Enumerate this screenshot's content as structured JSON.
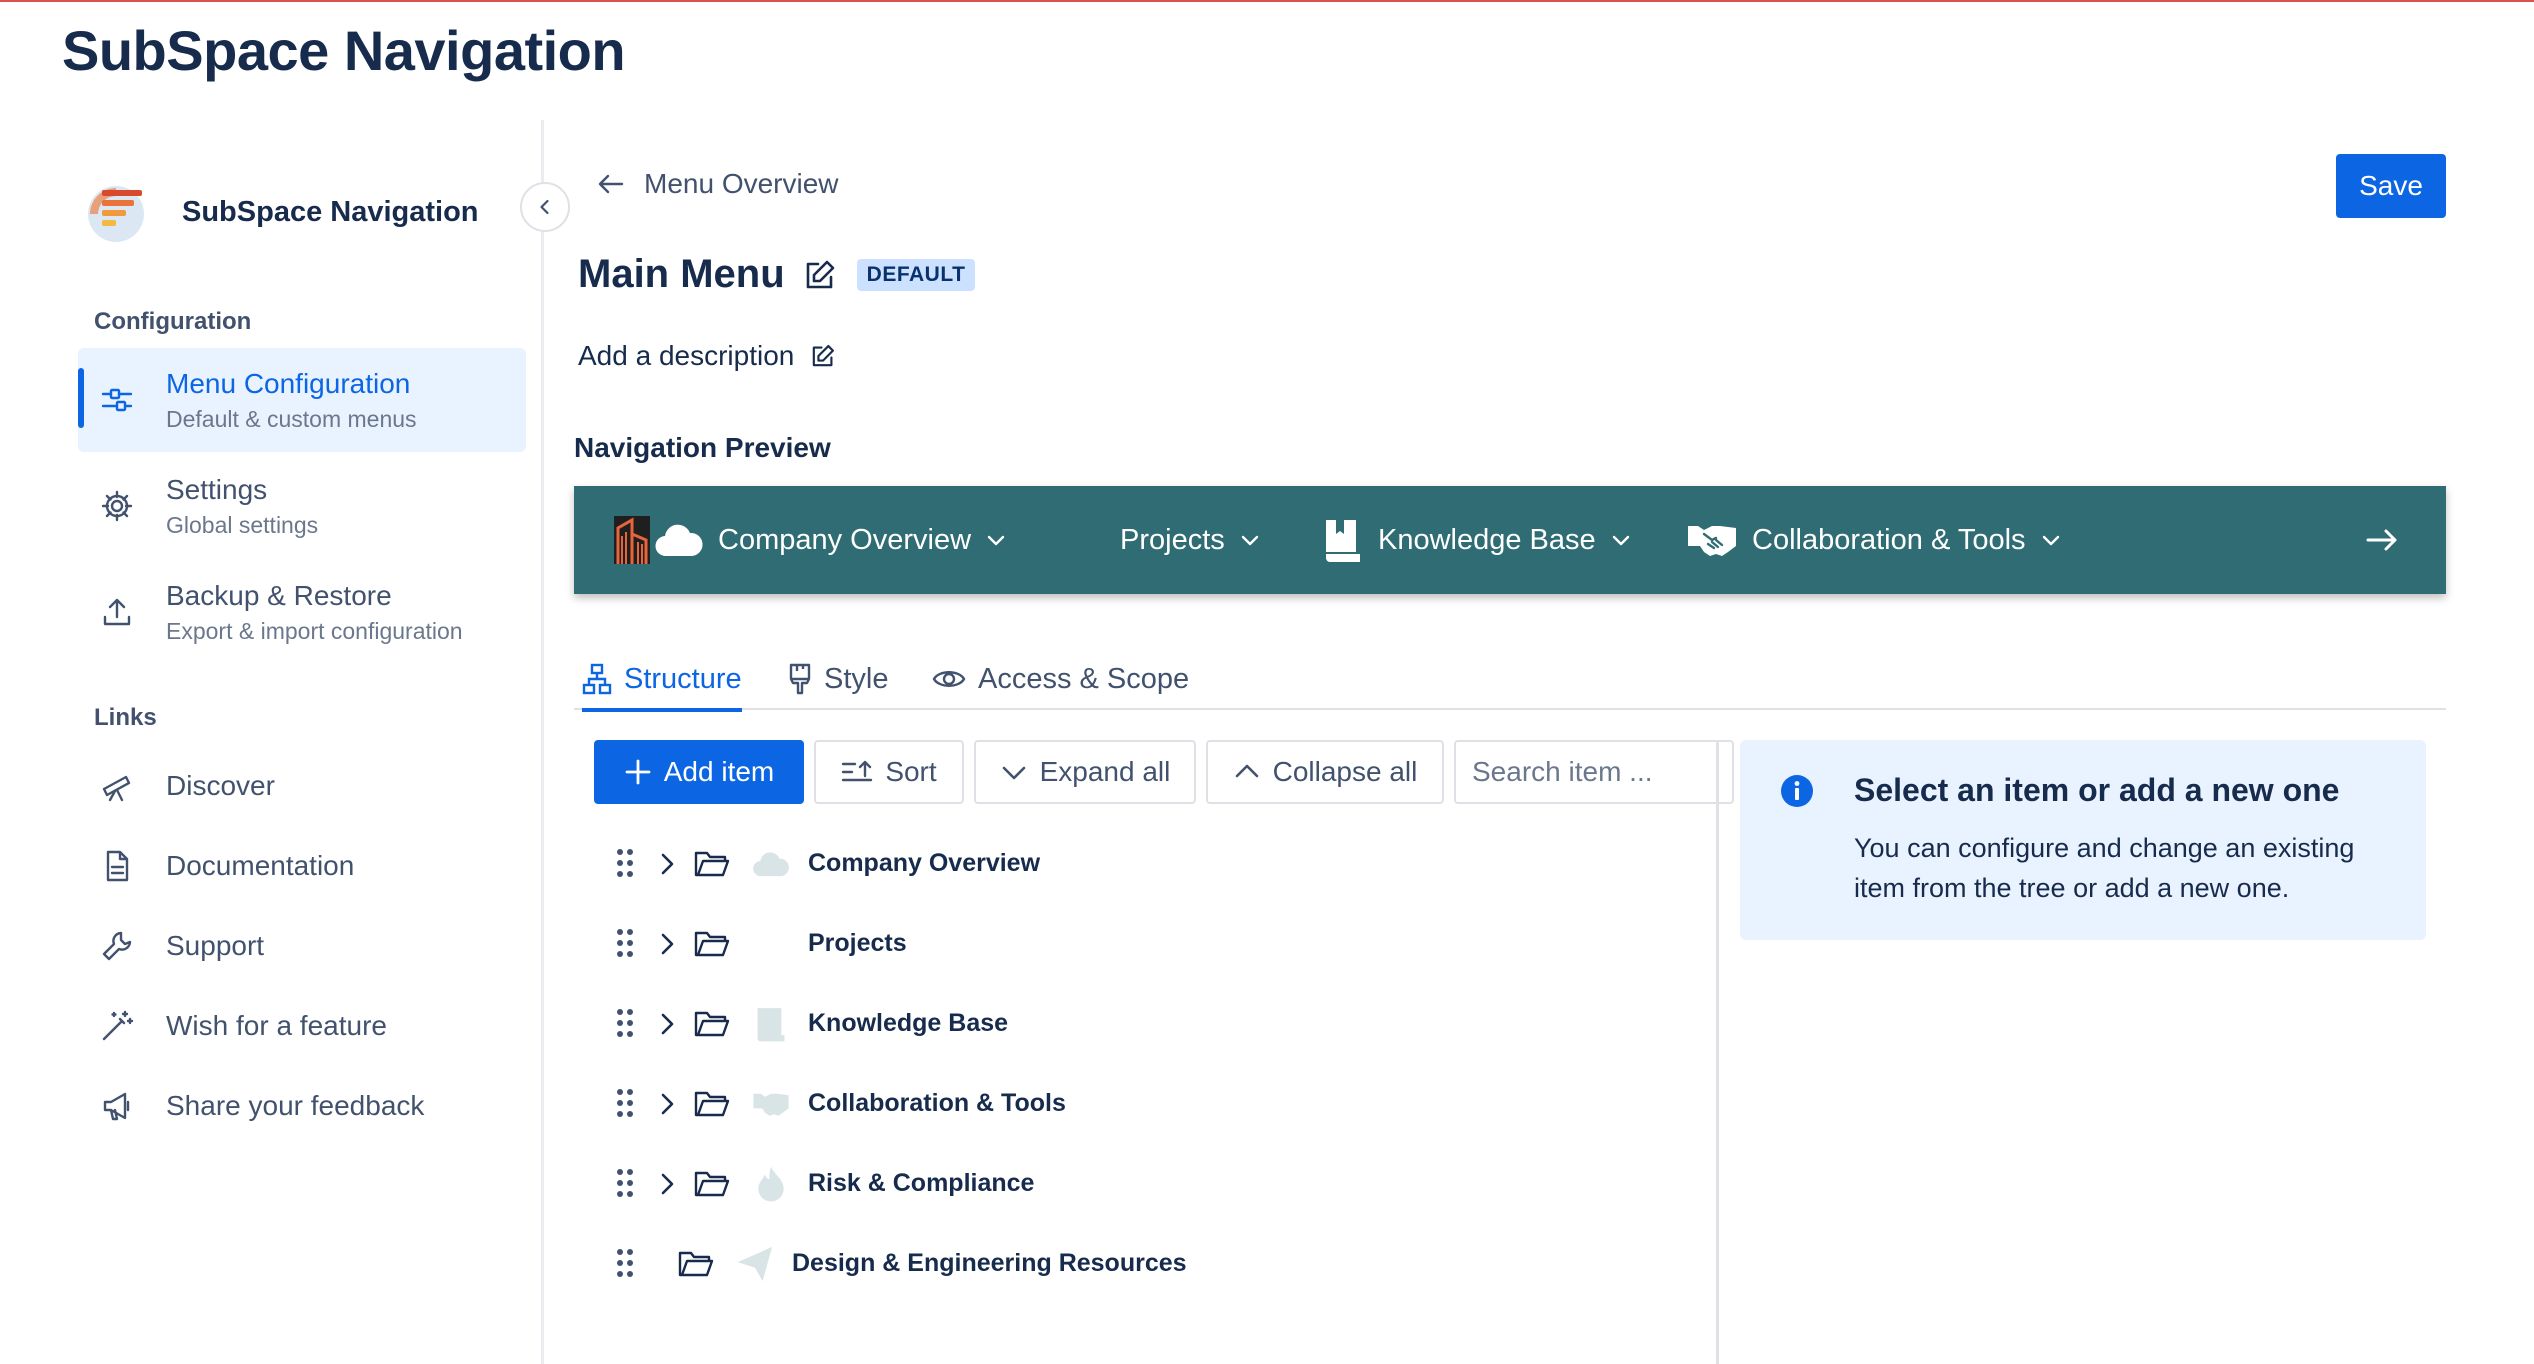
{
  "page": {
    "title": "SubSpace Navigation"
  },
  "sidebar": {
    "brand_name": "SubSpace Navigation",
    "configuration_label": "Configuration",
    "config_items": [
      {
        "title": "Menu Configuration",
        "subtitle": "Default & custom menus",
        "icon": "sliders-icon"
      },
      {
        "title": "Settings",
        "subtitle": "Global settings",
        "icon": "gear-icon"
      },
      {
        "title": "Backup & Restore",
        "subtitle": "Export & import configuration",
        "icon": "upload-icon"
      }
    ],
    "links_label": "Links",
    "links": [
      {
        "title": "Discover",
        "icon": "telescope-icon"
      },
      {
        "title": "Documentation",
        "icon": "document-icon"
      },
      {
        "title": "Support",
        "icon": "wrench-icon"
      },
      {
        "title": "Wish for a feature",
        "icon": "magic-wand-icon"
      },
      {
        "title": "Share your feedback",
        "icon": "megaphone-icon"
      }
    ]
  },
  "header": {
    "back_label": "Menu Overview",
    "save_label": "Save",
    "menu_title": "Main Menu",
    "badge": "DEFAULT",
    "description_placeholder": "Add a description",
    "preview_heading": "Navigation Preview"
  },
  "preview": {
    "bg_color": "#2f6c73",
    "items": [
      {
        "label": "Company Overview",
        "icon": "cloud-icon"
      },
      {
        "label": "Projects",
        "icon": ""
      },
      {
        "label": "Knowledge Base",
        "icon": "book-icon"
      },
      {
        "label": "Collaboration & Tools",
        "icon": "handshake-icon"
      }
    ]
  },
  "tabs": [
    {
      "label": "Structure",
      "icon": "hierarchy-icon",
      "active": true
    },
    {
      "label": "Style",
      "icon": "paintbrush-icon",
      "active": false
    },
    {
      "label": "Access & Scope",
      "icon": "eye-icon",
      "active": false
    }
  ],
  "toolbar": {
    "add_item": "Add item",
    "sort": "Sort",
    "expand_all": "Expand all",
    "collapse_all": "Collapse all",
    "search_placeholder": "Search item ..."
  },
  "tree": [
    {
      "label": "Company Overview",
      "has_children": true
    },
    {
      "label": "Projects",
      "has_children": true
    },
    {
      "label": "Knowledge Base",
      "has_children": true
    },
    {
      "label": "Collaboration & Tools",
      "has_children": true
    },
    {
      "label": "Risk & Compliance",
      "has_children": true
    },
    {
      "label": "Design & Engineering Resources",
      "has_children": false
    }
  ],
  "info": {
    "title": "Select an item or add a new one",
    "text": "You can configure and change an existing item from the tree or add a new one."
  },
  "colors": {
    "accent": "#0c66e4",
    "preview_bar": "#2f6c73",
    "info_bg": "#e9f2ff"
  }
}
